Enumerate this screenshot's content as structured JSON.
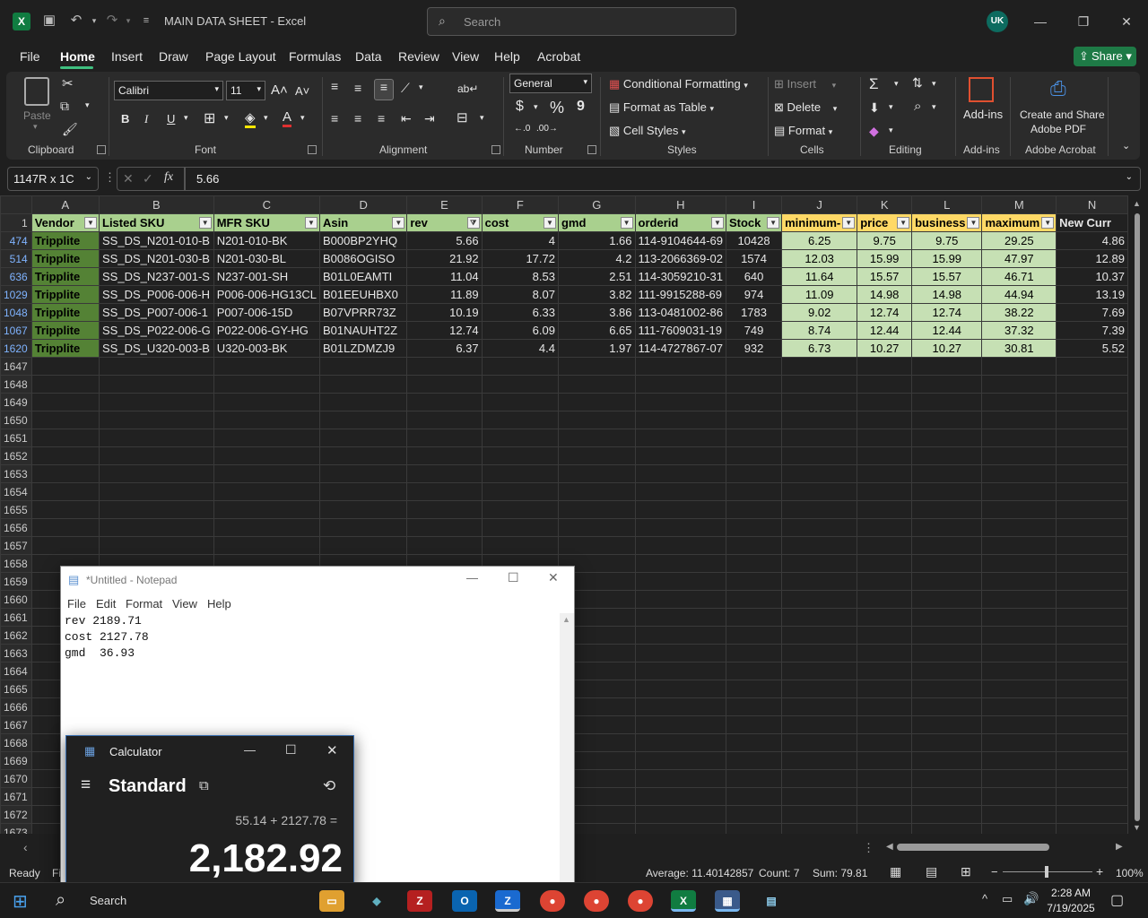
{
  "titlebar": {
    "doc_title": "MAIN DATA SHEET  -  Excel",
    "search_placeholder": "Search",
    "avatar_initials": "UK",
    "app_logo": "X"
  },
  "ribbon_tabs": [
    "File",
    "Home",
    "Insert",
    "Draw",
    "Page Layout",
    "Formulas",
    "Data",
    "Review",
    "View",
    "Help",
    "Acrobat"
  ],
  "active_tab": "Home",
  "share_label": "Share",
  "ribbon": {
    "clipboard": {
      "label": "Clipboard",
      "paste": "Paste"
    },
    "font": {
      "label": "Font",
      "name": "Calibri",
      "size": "11",
      "bold": "B",
      "italic": "I",
      "underline": "U"
    },
    "alignment": {
      "label": "Alignment"
    },
    "number": {
      "label": "Number",
      "format": "General",
      "currency": "$",
      "percent": "%",
      "comma": "9"
    },
    "styles": {
      "label": "Styles",
      "conditional": "Conditional Formatting",
      "format_table": "Format as Table",
      "cell_styles": "Cell Styles"
    },
    "cells": {
      "label": "Cells",
      "insert": "Insert",
      "delete": "Delete",
      "format": "Format"
    },
    "editing": {
      "label": "Editing"
    },
    "addins": {
      "label": "Add-ins",
      "button": "Add-ins"
    },
    "acrobat": {
      "label": "Adobe Acrobat",
      "line1": "Create and Share",
      "line2": "Adobe PDF"
    }
  },
  "formula_bar": {
    "name_box": "1147R x 1C",
    "formula": "5.66",
    "fx": "fx"
  },
  "grid": {
    "columns": [
      "A",
      "B",
      "C",
      "D",
      "E",
      "F",
      "G",
      "H",
      "I",
      "J",
      "K",
      "L",
      "M",
      "N"
    ],
    "header_row_number": "1",
    "headers": [
      "Vendor",
      "Listed SKU",
      "MFR SKU",
      "Asin",
      "rev",
      "cost",
      "gmd",
      "orderid",
      "Stock",
      "minimum-",
      "price",
      "business",
      "maximum",
      "New Curr"
    ],
    "rows": [
      {
        "n": "474",
        "cells": [
          "Tripplite",
          "SS_DS_N201-010-B",
          "N201-010-BK",
          "B000BP2YHQ",
          "5.66",
          "4",
          "1.66",
          "114-9104644-69",
          "10428",
          "6.25",
          "9.75",
          "9.75",
          "29.25",
          "4.86"
        ]
      },
      {
        "n": "514",
        "cells": [
          "Tripplite",
          "SS_DS_N201-030-B",
          "N201-030-BL",
          "B0086OGISO",
          "21.92",
          "17.72",
          "4.2",
          "113-2066369-02",
          "1574",
          "12.03",
          "15.99",
          "15.99",
          "47.97",
          "12.89"
        ]
      },
      {
        "n": "636",
        "cells": [
          "Tripplite",
          "SS_DS_N237-001-S",
          "N237-001-SH",
          "B01L0EAMTI",
          "11.04",
          "8.53",
          "2.51",
          "114-3059210-31",
          "640",
          "11.64",
          "15.57",
          "15.57",
          "46.71",
          "10.37"
        ]
      },
      {
        "n": "1029",
        "cells": [
          "Tripplite",
          "SS_DS_P006-006-H",
          "P006-006-HG13CL",
          "B01EEUHBX0",
          "11.89",
          "8.07",
          "3.82",
          "111-9915288-69",
          "974",
          "11.09",
          "14.98",
          "14.98",
          "44.94",
          "13.19"
        ]
      },
      {
        "n": "1048",
        "cells": [
          "Tripplite",
          "SS_DS_P007-006-1",
          "P007-006-15D",
          "B07VPRR73Z",
          "10.19",
          "6.33",
          "3.86",
          "113-0481002-86",
          "1783",
          "9.02",
          "12.74",
          "12.74",
          "38.22",
          "7.69"
        ]
      },
      {
        "n": "1067",
        "cells": [
          "Tripplite",
          "SS_DS_P022-006-G",
          "P022-006-GY-HG",
          "B01NAUHT2Z",
          "12.74",
          "6.09",
          "6.65",
          "111-7609031-19",
          "749",
          "8.74",
          "12.44",
          "12.44",
          "37.32",
          "7.39"
        ]
      },
      {
        "n": "1620",
        "cells": [
          "Tripplite",
          "SS_DS_U320-003-B",
          "U320-003-BK",
          "B01LZDMZJ9",
          "6.37",
          "4.4",
          "1.97",
          "114-4727867-07",
          "932",
          "6.73",
          "10.27",
          "10.27",
          "30.81",
          "5.52"
        ]
      }
    ],
    "empty_rows": [
      "1647",
      "1648",
      "1649",
      "1650",
      "1651",
      "1652",
      "1653",
      "1654",
      "1655",
      "1656",
      "1657",
      "1658",
      "1659",
      "1660",
      "1661",
      "1662",
      "1663",
      "1664",
      "1665",
      "1666",
      "1667",
      "1668",
      "1669",
      "1670",
      "1671",
      "1672",
      "1673"
    ]
  },
  "status": {
    "ready": "Ready",
    "fi": "Fi",
    "average": "Average: 11.40142857",
    "count": "Count: 7",
    "sum": "Sum: 79.81",
    "zoom": "100%"
  },
  "notepad": {
    "title": "*Untitled - Notepad",
    "menu": [
      "File",
      "Edit",
      "Format",
      "View",
      "Help"
    ],
    "text": "rev 2189.71\ncost 2127.78\ngmd  36.93"
  },
  "calculator": {
    "title": "Calculator",
    "mode": "Standard",
    "expression": "55.14 + 2127.78 =",
    "result": "2,182.92"
  },
  "taskbar": {
    "search": "Search",
    "time": "2:28 AM",
    "date": "7/19/2025"
  }
}
